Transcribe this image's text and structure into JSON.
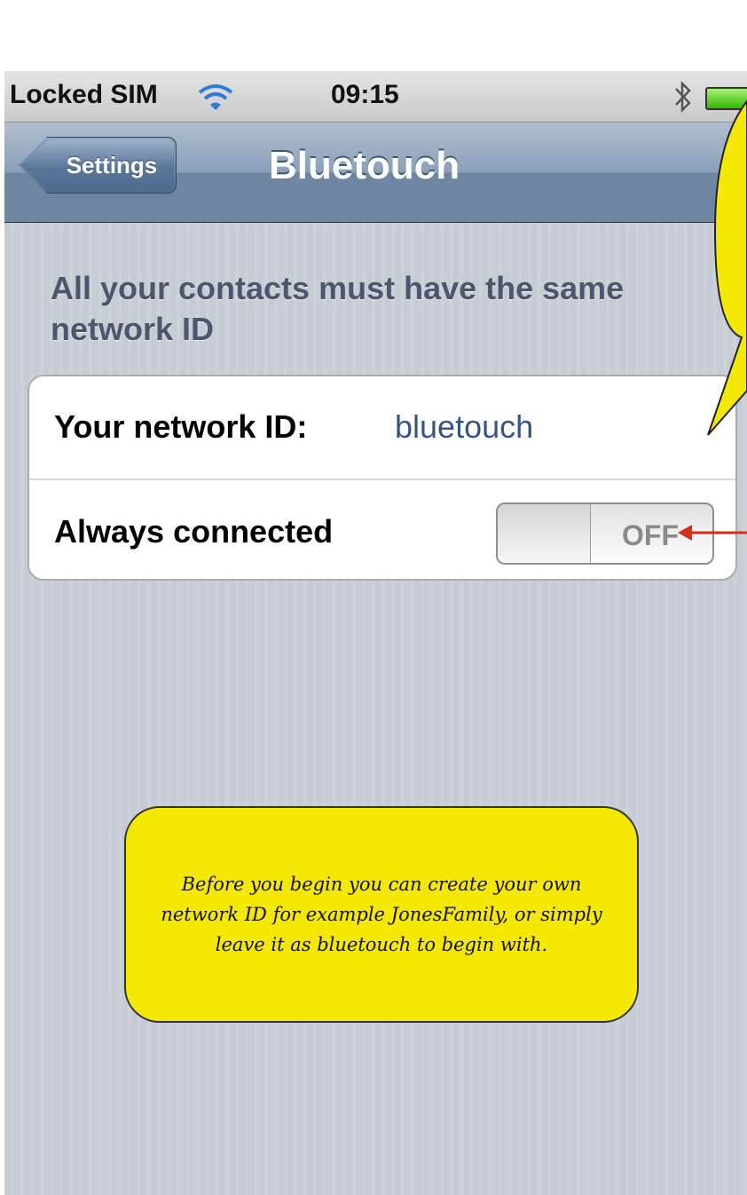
{
  "status_bar": {
    "carrier": "Locked SIM",
    "time": "09:15",
    "wifi_icon": "wifi-icon",
    "bluetooth_icon": "bluetooth-icon",
    "battery_icon": "battery-icon"
  },
  "nav": {
    "back_label": "Settings",
    "title": "Bluetouch"
  },
  "section": {
    "header": "All your contacts must have the same network ID"
  },
  "rows": {
    "network_id_label": "Your network ID:",
    "network_id_value": "bluetouch",
    "always_connected_label": "Always connected",
    "toggle_state": "OFF"
  },
  "callout": {
    "text": "Before you begin you can create your own network ID for example JonesFamily, or simply leave it as bluetouch to begin with."
  },
  "colors": {
    "nav_bar": "#6d86a2",
    "value_text": "#385487",
    "callout_fill": "#f5e903",
    "arrow": "#d32f1e"
  }
}
